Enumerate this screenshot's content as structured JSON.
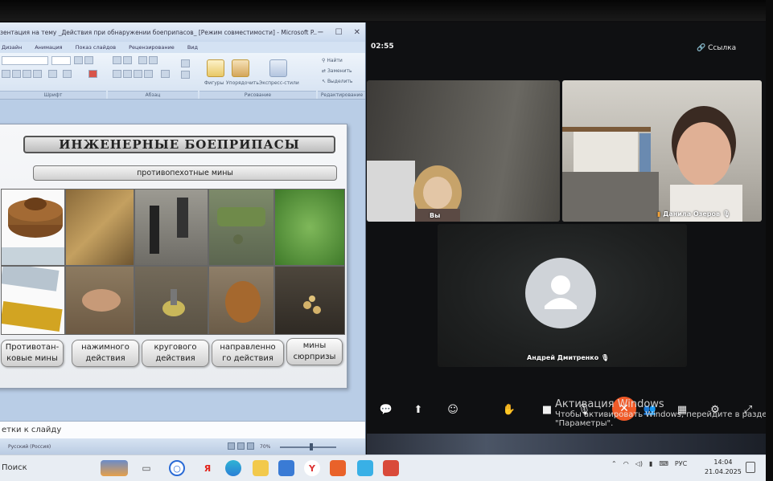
{
  "ppt": {
    "title": "зентация на тему _Действия при обнаружении боеприпасов_ [Режим совместимости] - Microsoft P...",
    "menu": [
      "Дизайн",
      "Анимация",
      "Показ слайдов",
      "Рецензирование",
      "Вид"
    ],
    "ribbon": {
      "figures": "Фигуры",
      "arrange": "Упорядочить",
      "express_styles": "Экспресс-стили",
      "find": "Найти",
      "replace": "Заменить",
      "select": "Выделить",
      "group_font": "Шрифт",
      "group_paragraph": "Абзац",
      "group_drawing": "Рисование",
      "group_editing": "Редактирование"
    },
    "slide": {
      "title": "ИНЖЕНЕРНЫЕ БОЕПРИПАСЫ",
      "subtitle": "противопехотные мины",
      "captions": [
        "Противотан-\nковые мины",
        "нажимного\nдействия",
        "кругового\nдействия",
        "направленно\nго действия",
        "мины\nсюрпризы"
      ]
    },
    "notes": "етки к слайду",
    "status": {
      "language": "Русский (Россия)",
      "zoom": "70%"
    }
  },
  "call": {
    "timer": "02:55",
    "link": "Ссылка",
    "participants": [
      {
        "name": "Вы"
      },
      {
        "name": "Данила Озеров"
      },
      {
        "name": "Андрей Дмитренко"
      }
    ]
  },
  "watermark": {
    "title": "Активация Windows",
    "line1": "Чтобы активировать Windows, перейдите в раздел",
    "line2": "\"Параметры\"."
  },
  "taskbar": {
    "search": "Поиск",
    "lang": "РУС",
    "time": "14:04",
    "date": "21.04.2025"
  },
  "colors": {
    "leave_button": "#f05a28",
    "ribbon_bg": "#dfe9f5",
    "call_bg": "#0f1012"
  }
}
